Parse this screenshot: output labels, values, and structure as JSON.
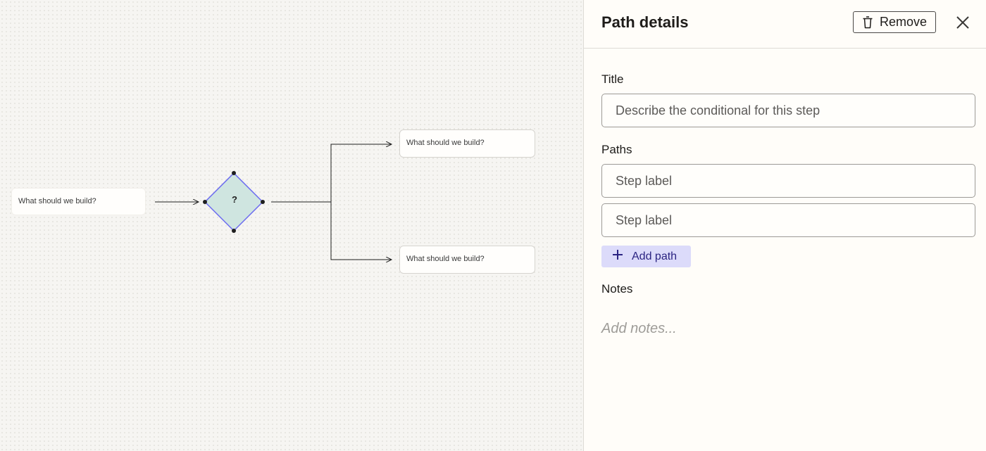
{
  "canvas": {
    "nodes": {
      "start_text": "What should we build?",
      "top_text": "What should we build?",
      "bottom_text": "What should we build?"
    },
    "decision_label": "?",
    "colors": {
      "diamond_fill": "#cfe5e0",
      "diamond_stroke": "#6b6bf0",
      "connector": "#1e1e1e"
    }
  },
  "panel": {
    "title": "Path details",
    "remove_label": "Remove",
    "remove_icon": "trash-icon",
    "close_icon": "close-icon",
    "title_field": {
      "label": "Title",
      "placeholder": "Describe the conditional for this step"
    },
    "paths_field": {
      "label": "Paths",
      "items": [
        {
          "placeholder": "Step label"
        },
        {
          "placeholder": "Step label"
        }
      ],
      "add_label": "Add path",
      "add_icon": "plus-icon"
    },
    "notes_field": {
      "label": "Notes",
      "placeholder": "Add notes..."
    },
    "colors": {
      "accent_bg": "#dcdbfa",
      "accent_text": "#2b2482"
    }
  }
}
